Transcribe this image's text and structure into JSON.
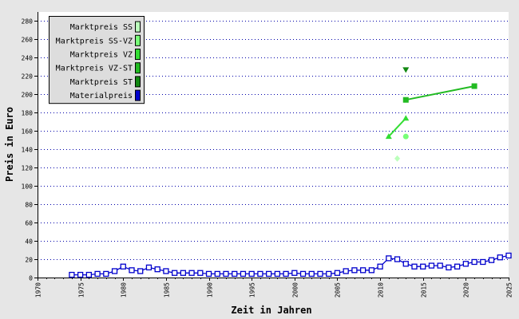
{
  "chart_data": {
    "type": "line",
    "xlabel": "Zeit in Jahren",
    "ylabel": "Preis in Euro",
    "xlim": [
      1970,
      2025
    ],
    "ylim": [
      0,
      290
    ],
    "x_ticks": [
      1970,
      1975,
      1980,
      1985,
      1990,
      1995,
      2000,
      2005,
      2010,
      2015,
      2020,
      2025
    ],
    "y_ticks": [
      0,
      20,
      40,
      60,
      80,
      100,
      120,
      140,
      160,
      180,
      200,
      220,
      240,
      260,
      280
    ],
    "grid": "horizontal dotted",
    "legend_position": "top-left",
    "series": [
      {
        "name": "Marktpreis SS",
        "color": "#bbffbb",
        "marker": "diamond",
        "points": [
          [
            2012,
            130
          ]
        ]
      },
      {
        "name": "Marktpreis SS-VZ",
        "color": "#77ff77",
        "marker": "circle",
        "points": [
          [
            2013,
            154
          ]
        ]
      },
      {
        "name": "Marktpreis VZ",
        "color": "#33dd33",
        "marker": "triangle-up",
        "points": [
          [
            2011,
            154
          ],
          [
            2013,
            174
          ]
        ]
      },
      {
        "name": "Marktpreis VZ-ST",
        "color": "#22bb22",
        "marker": "square",
        "points": [
          [
            2013,
            194
          ],
          [
            2021,
            209
          ]
        ]
      },
      {
        "name": "Marktpreis ST",
        "color": "#118811",
        "marker": "triangle-down",
        "points": [
          [
            2013,
            227
          ]
        ]
      },
      {
        "name": "Materialpreis",
        "color": "#0000cc",
        "marker": "open-square",
        "points": [
          [
            1974,
            3
          ],
          [
            1975,
            3
          ],
          [
            1976,
            3
          ],
          [
            1977,
            4
          ],
          [
            1978,
            4
          ],
          [
            1979,
            7
          ],
          [
            1980,
            12
          ],
          [
            1981,
            8
          ],
          [
            1982,
            7
          ],
          [
            1983,
            11
          ],
          [
            1984,
            9
          ],
          [
            1985,
            7
          ],
          [
            1986,
            5
          ],
          [
            1987,
            5
          ],
          [
            1988,
            5
          ],
          [
            1989,
            5
          ],
          [
            1990,
            4
          ],
          [
            1991,
            4
          ],
          [
            1992,
            4
          ],
          [
            1993,
            4
          ],
          [
            1994,
            4
          ],
          [
            1995,
            4
          ],
          [
            1996,
            4
          ],
          [
            1997,
            4
          ],
          [
            1998,
            4
          ],
          [
            1999,
            4
          ],
          [
            2000,
            5
          ],
          [
            2001,
            4
          ],
          [
            2002,
            4
          ],
          [
            2003,
            4
          ],
          [
            2004,
            4
          ],
          [
            2005,
            5
          ],
          [
            2006,
            7
          ],
          [
            2007,
            8
          ],
          [
            2008,
            8
          ],
          [
            2009,
            8
          ],
          [
            2010,
            12
          ],
          [
            2011,
            21
          ],
          [
            2012,
            20
          ],
          [
            2013,
            15
          ],
          [
            2014,
            12
          ],
          [
            2015,
            12
          ],
          [
            2016,
            13
          ],
          [
            2017,
            13
          ],
          [
            2018,
            11
          ],
          [
            2019,
            12
          ],
          [
            2020,
            15
          ],
          [
            2021,
            17
          ],
          [
            2022,
            17
          ],
          [
            2023,
            19
          ],
          [
            2024,
            22
          ],
          [
            2025,
            24
          ]
        ]
      }
    ]
  },
  "colors": {
    "frame": "#e6e6e6",
    "plot_background": "#ffffff",
    "grid": "#0000aa",
    "legend_background": "#dddddd"
  }
}
